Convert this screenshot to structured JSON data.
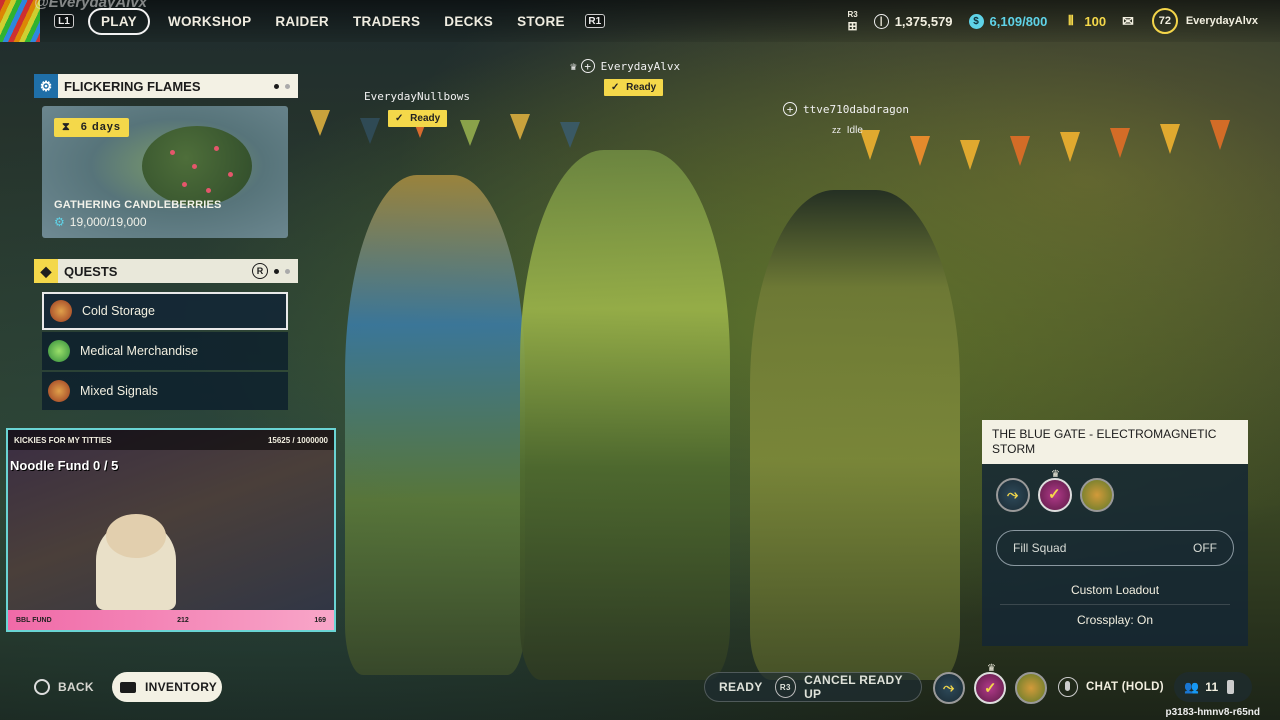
{
  "overlay_handle": "@EverydayAlvx",
  "nav": {
    "left_hint": "L1",
    "right_hint": "R1",
    "items": [
      "PLAY",
      "WORKSHOP",
      "RAIDER",
      "TRADERS",
      "DECKS",
      "STORE"
    ]
  },
  "currencies": {
    "r3_hint": "R3",
    "coins": "1,375,579",
    "tokens": "6,109/800",
    "credits": "100",
    "level": "72",
    "username": "EverydayAlvx"
  },
  "event": {
    "header": "FLICKERING FLAMES",
    "timer": "6 days",
    "title": "GATHERING CANDLEBERRIES",
    "progress": "19,000/19,000"
  },
  "quests": {
    "header": "QUESTS",
    "hint": "R",
    "items": [
      {
        "label": "Cold Storage",
        "color": "#c9532d"
      },
      {
        "label": "Medical Merchandise",
        "color": "#4fb54a"
      },
      {
        "label": "Mixed Signals",
        "color": "#c9532d"
      }
    ]
  },
  "stream": {
    "top_left": "KICKIES FOR MY TITTIES",
    "top_right": "15625 / 1000000",
    "goal": "Noodle Fund  0 / 5",
    "bottom_left": "BBL FUND",
    "bottom_mid": "212",
    "bottom_right": "169"
  },
  "players": [
    {
      "name": "EverydayNullbows",
      "status": "Ready"
    },
    {
      "name": "EverydayAlvx",
      "status": "Ready"
    },
    {
      "name": "ttve710dabdragon",
      "status": "Idle"
    }
  ],
  "map": {
    "title": "THE BLUE GATE - ELECTROMAGNETIC STORM",
    "fill_squad_label": "Fill Squad",
    "fill_squad_value": "OFF",
    "custom_loadout": "Custom Loadout",
    "crossplay": "Crossplay: On"
  },
  "bottom": {
    "back": "BACK",
    "inventory": "INVENTORY",
    "ready": "READY",
    "r3": "R3",
    "cancel": "CANCEL READY UP",
    "chat": "CHAT (HOLD)",
    "friends": "11",
    "code": "p3183-hmnv8-r65nd"
  },
  "colors": {
    "accent_yellow": "#f4d84a",
    "panel_light": "#f3f1e4",
    "panel_dark": "#142634",
    "event_icon": "#1f6fa8",
    "quest_icon": "#1f1f1f"
  }
}
